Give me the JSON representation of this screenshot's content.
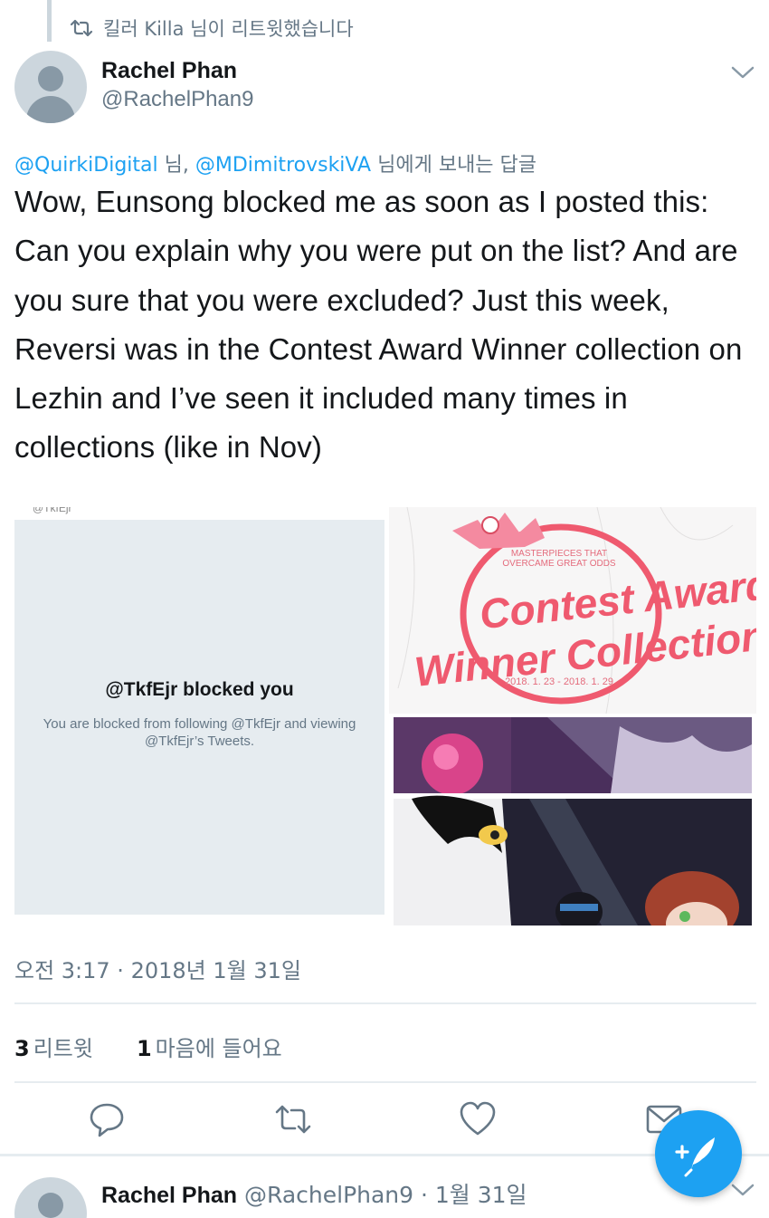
{
  "retweet_context": {
    "text": "킬러 Killa 님이 리트윗했습니다"
  },
  "tweet": {
    "author_name": "Rachel Phan",
    "author_handle": "@RachelPhan9",
    "reply_to": {
      "mention1": "@QuirkiDigital",
      "sep1": " 님, ",
      "mention2": "@MDimitrovskiVA",
      "suffix": " 님에게 보내는 답글"
    },
    "text": "Wow, Eunsong blocked me as soon as I posted this: Can you explain why you were put on the list? And are you sure that you were excluded? Just this week, Reversi was in the Contest Award Winner collection on Lezhin and I’ve seen it included many times in collections (like in Nov)",
    "timestamp": "오전 3:17 · 2018년 1월 31일",
    "retweets_count": "3",
    "retweets_label": "리트윗",
    "likes_count": "1",
    "likes_label": "마음에 들어요"
  },
  "media": {
    "blocked_handle_cut": "@TkfEjr",
    "blocked_title": "@TkfEjr blocked you",
    "blocked_subtitle": "You are blocked from following @TkfEjr and viewing @TkfEjr’s Tweets.",
    "poster_masterpieces": "MASTERPIECES THAT",
    "poster_overcame": "OVERCAME GREAT ODDS",
    "poster_title1": "Contest Award",
    "poster_title2": "Winner Collection",
    "poster_dates": "2018. 1. 23 - 2018. 1. 29"
  },
  "next_tweet": {
    "author_name": "Rachel Phan",
    "rest": " @RachelPhan9 · 1월 31일"
  },
  "colors": {
    "accent": "#1da1f2",
    "muted": "#657786",
    "poster_pink": "#ef5a6f"
  },
  "icons": [
    "retweet-icon",
    "chevron-down-icon",
    "reply-icon",
    "like-icon",
    "dm-icon",
    "compose-icon"
  ]
}
